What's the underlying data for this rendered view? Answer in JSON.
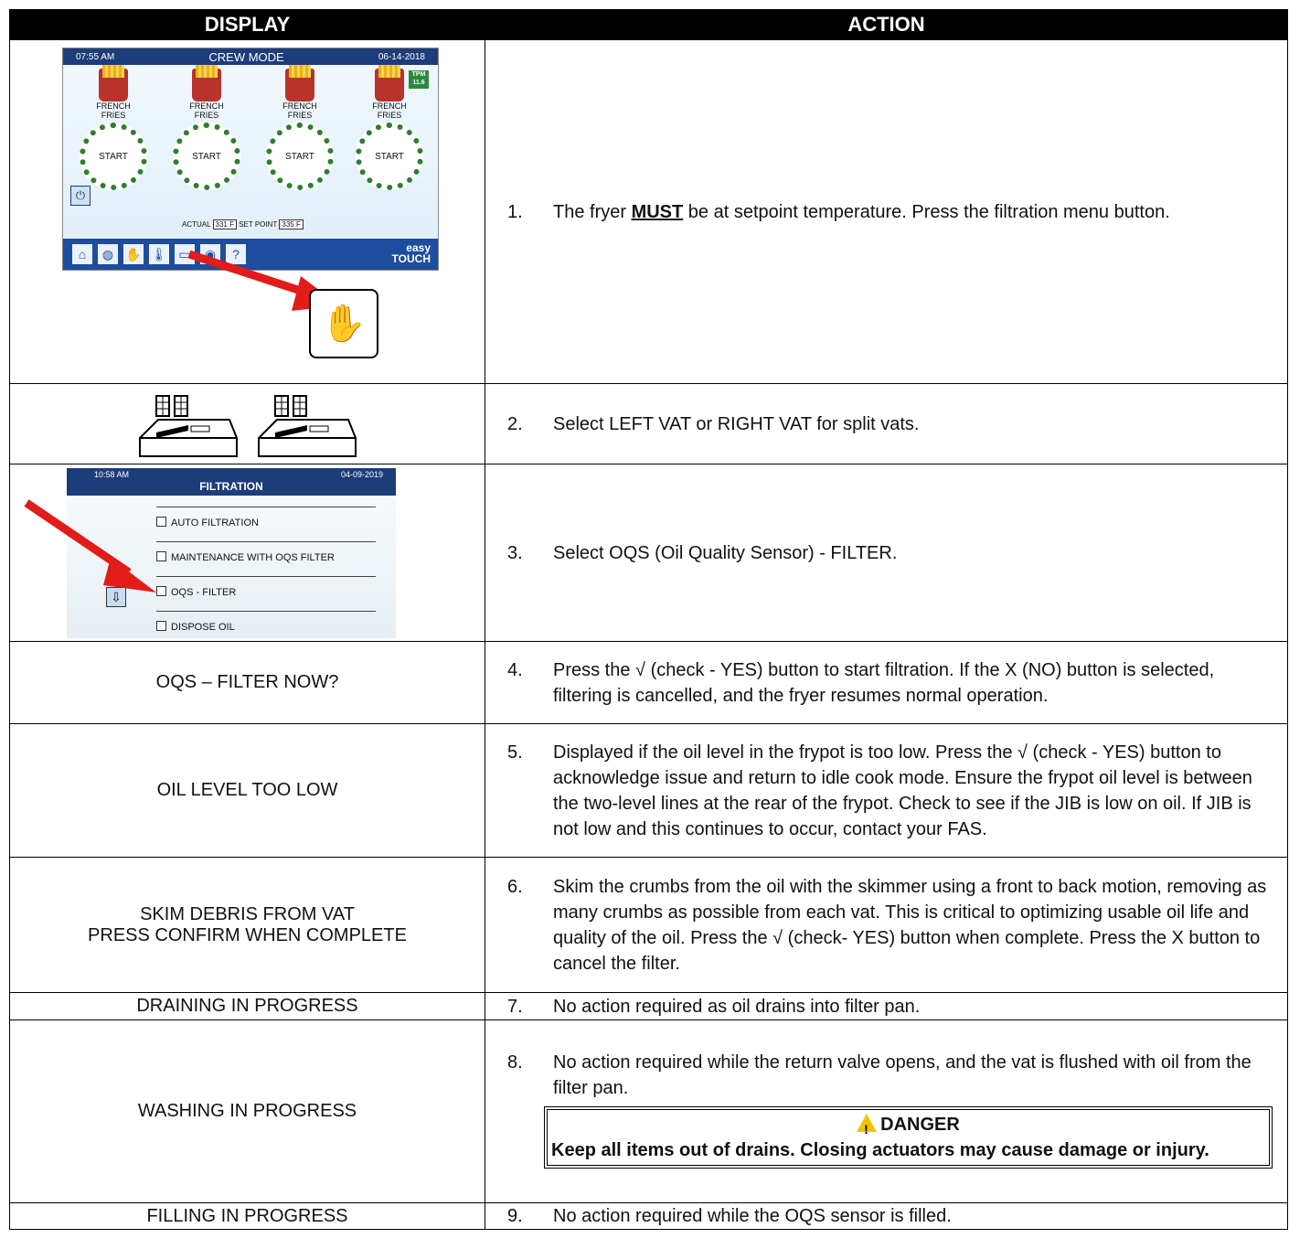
{
  "headers": {
    "display": "DISPLAY",
    "action": "ACTION"
  },
  "screen1": {
    "time": "07:55 AM",
    "mode": "CREW MODE",
    "date": "06-14-2018",
    "product_line1": "FRENCH",
    "product_line2": "FRIES",
    "start": "START",
    "tpm_label": "TPM",
    "tpm_value": "11.6",
    "actual_label": "ACTUAL",
    "actual_value": "331 F",
    "setpoint_label": "SET POINT",
    "setpoint_value": "335 F",
    "brand_line1": "easy",
    "brand_line2": "TOUCH",
    "help": "?"
  },
  "screen2": {
    "time": "10:58 AM",
    "date": "04-09-2019",
    "title": "FILTRATION",
    "options": [
      "AUTO FILTRATION",
      "MAINTENANCE WITH OQS FILTER",
      "OQS - FILTER",
      "DISPOSE OIL"
    ]
  },
  "rows": [
    {
      "num": "1.",
      "pre": "The fryer ",
      "must": "MUST",
      "post": " be at setpoint temperature. Press the filtration menu button."
    },
    {
      "num": "2.",
      "text": "Select LEFT VAT or RIGHT VAT for split vats."
    },
    {
      "num": "3.",
      "text": "Select OQS (Oil Quality Sensor) - FILTER."
    },
    {
      "display": "OQS – FILTER NOW?",
      "num": "4.",
      "text": "Press the √ (check - YES) button to start filtration. If the X (NO) button is selected, filtering is cancelled, and the fryer resumes normal operation."
    },
    {
      "display": "OIL LEVEL TOO LOW",
      "num": "5.",
      "text": "Displayed if the oil level in the frypot is too low.  Press the √ (check - YES) button to acknowledge issue and return to idle cook mode. Ensure the frypot oil level is between the two-level lines at the rear of the frypot. Check to see if the JIB is low on oil. If JIB is not low and this continues to occur, contact your FAS."
    },
    {
      "display1": "SKIM DEBRIS FROM VAT",
      "display2": "PRESS CONFIRM WHEN COMPLETE",
      "num": "6.",
      "text": "Skim the crumbs from the oil with the skimmer using a front to back motion, removing as many crumbs as possible from each vat.  This is critical to optimizing usable oil life and quality of the oil.  Press the √ (check- YES) button when complete.  Press the X button to cancel the filter."
    },
    {
      "display": "DRAINING IN PROGRESS",
      "num": "7.",
      "text": "No action required as oil drains into filter pan."
    },
    {
      "display": "WASHING IN PROGRESS",
      "num": "8.",
      "text": "No action required while the return valve opens, and the vat is flushed with oil from the filter pan.",
      "danger_title": "DANGER",
      "danger_text": "Keep all items out of drains. Closing actuators may cause damage or injury."
    },
    {
      "display": "FILLING IN PROGRESS",
      "num": "9.",
      "text": "No action required while the OQS sensor is filled."
    }
  ]
}
